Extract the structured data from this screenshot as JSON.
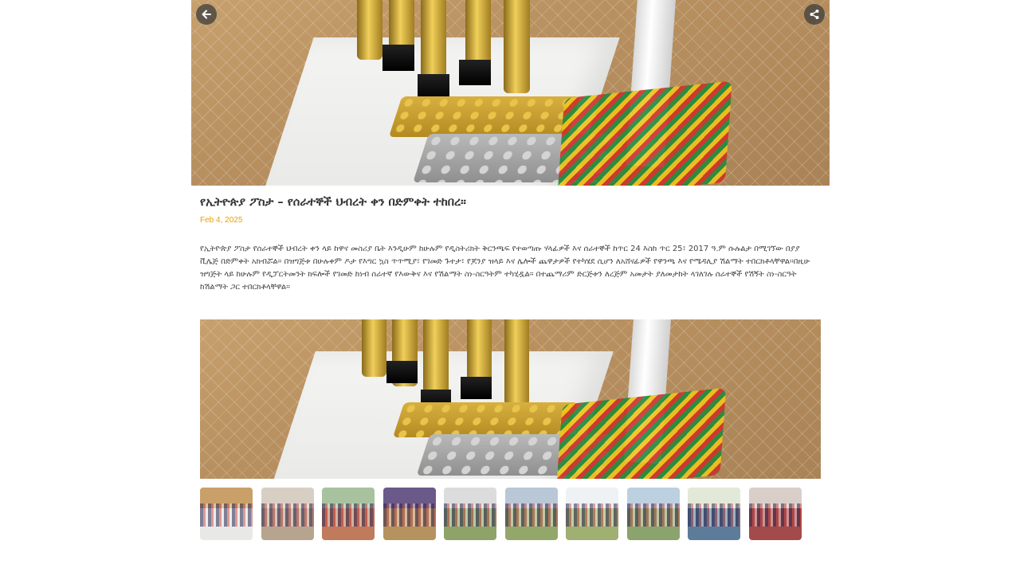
{
  "article": {
    "title": "የኢትዮጵያ ፖስታ – የሰራተኞች ህብረት ቀን በድምቀት ተከበረ።",
    "date": "Feb 4, 2025",
    "body": "የኢትዮጵያ ፖስታ የሰራተኞች ህብረት ቀን ላይ ከዋና መስሪያ ቤት እንዲሁም ከሁሉም የዲስትሪክት ቅርንጫፍ የተወጣጡ ሃላፊዎች እና ሰራተኞች ከጥር 24 እስከ ጥር 25፣ 2017 ዓ.ም ሱሉልታ በሚገኘው በያያ ቪሌጅ በድምቀት አክብሯል። በዝግጅቱ በሁሉቀም ዶታ የእግር ኳስ ጥጥሚያ፣ የገመድ ጉተታ፣ የጆንያ ዝላይ እና ሌሎች ጨዋታዎች የተካሄደ ሲሆን ለአሸናፊዎች የዋንጫ እና የሜዳሊያ ሽልማት ተበርክቶላቸዋል።በዚሁ ዝግጅት ላይ ከሁሉም የዲፓርትመንት ክፍሎች የገመድ ከነብ ሰራተኛ የእውቅና እና የሽልማት ስነ-ስርዓትም ተካሂዷል። በተጨማሪም ድርጅቱን ለረጅም አመታት ያለመታከት ላገለገሉ ሰራተኞች የሽኝት ስነ-ስርዓት ከሽልማት ጋር ተበርክቶላቸዋል።"
  },
  "icons": {
    "back": "arrow-left-icon",
    "share": "share-icon"
  },
  "gallery": {
    "thumbnails": [
      {
        "name": "trophies",
        "sky": "#c9a06a",
        "ground": "#e8e8e6"
      },
      {
        "name": "speaker",
        "sky": "#d8cfc4",
        "ground": "#b7a48f"
      },
      {
        "name": "group-photo",
        "sky": "#a8c2a0",
        "ground": "#c07a5c"
      },
      {
        "name": "tug-of-war",
        "sky": "#6a5a8a",
        "ground": "#b6925e"
      },
      {
        "name": "crowd-field",
        "sky": "#dcdcdc",
        "ground": "#8ea36a"
      },
      {
        "name": "football-1",
        "sky": "#b9c7d6",
        "ground": "#93a76b"
      },
      {
        "name": "tent-field",
        "sky": "#eef2f5",
        "ground": "#9fb072"
      },
      {
        "name": "football-2",
        "sky": "#bcd0e0",
        "ground": "#8ba36c"
      },
      {
        "name": "award-group",
        "sky": "#e3e9d8",
        "ground": "#5d7c9a"
      },
      {
        "name": "hall-audience",
        "sky": "#d9cfc8",
        "ground": "#a34a4a"
      }
    ]
  }
}
